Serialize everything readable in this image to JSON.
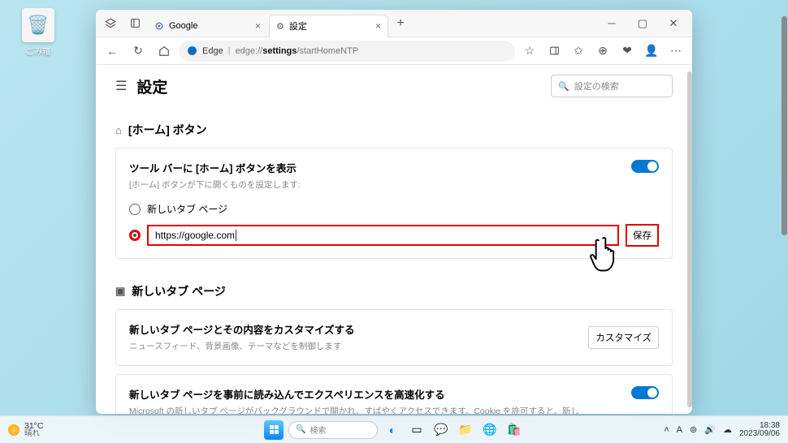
{
  "desktop": {
    "recycle_bin": "ごみ箱"
  },
  "browser": {
    "tabs": [
      {
        "title": "Google",
        "favicon": "google"
      },
      {
        "title": "設定",
        "favicon": "gear"
      }
    ],
    "address": {
      "provider": "Edge",
      "path_prefix": "edge://",
      "path_bold": "settings",
      "path_suffix": "/startHomeNTP"
    }
  },
  "settings": {
    "title": "設定",
    "search_placeholder": "設定の検索",
    "home_section": {
      "title": "[ホーム] ボタン",
      "option_label": "ツール バーに [ホーム] ボタンを表示",
      "option_sub": "[ホーム] ボタンが下に開くものを設定します:",
      "radio_newtab": "新しいタブ ページ",
      "url_value": "https://google.com",
      "save": "保存"
    },
    "newtab_section": {
      "title": "新しいタブ ページ",
      "custom_label": "新しいタブ ページとその内容をカスタマイズする",
      "custom_sub": "ニュースフィード、背景画像、テーマなどを制御します",
      "custom_btn": "カスタマイズ",
      "preload_label": "新しいタブ ページを事前に読み込んでエクスペリエンスを高速化する",
      "preload_sub": "Microsoft の新しいタブ ページがバックグラウンドで開かれ、すばやくアクセスできます。Cookie を許可すると、新しいタブ ページのコンテンツに Cookie が含まれる場合があります"
    }
  },
  "taskbar": {
    "weather_temp": "31°C",
    "weather_cond": "晴れ",
    "search_placeholder": "検索",
    "ime": "A",
    "time": "18:38",
    "date": "2023/09/06"
  }
}
